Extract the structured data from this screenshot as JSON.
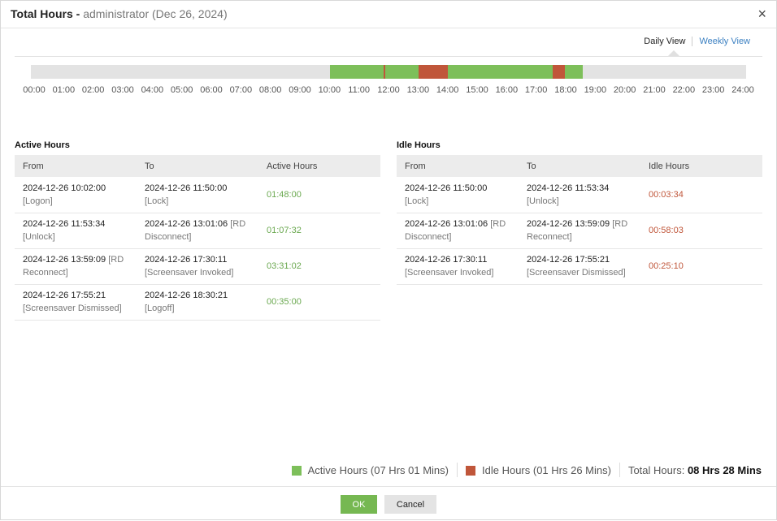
{
  "header": {
    "title": "Total Hours - ",
    "subtitle": "administrator (Dec 26, 2024)",
    "close_icon": "close-icon"
  },
  "views": {
    "daily": "Daily View",
    "weekly": "Weekly View"
  },
  "colors": {
    "active": "#7dbf5a",
    "idle": "#c0563a",
    "timeline_bg": "#e3e3e3",
    "ok_button": "#76b852"
  },
  "timeline": {
    "range_hours": [
      0,
      24
    ],
    "segments": [
      {
        "type": "active",
        "start": "10:02:00",
        "end": "11:50:00"
      },
      {
        "type": "idle",
        "start": "11:50:00",
        "end": "11:53:34"
      },
      {
        "type": "active",
        "start": "11:53:34",
        "end": "13:01:06"
      },
      {
        "type": "idle",
        "start": "13:01:06",
        "end": "13:59:09"
      },
      {
        "type": "active",
        "start": "13:59:09",
        "end": "17:30:11"
      },
      {
        "type": "idle",
        "start": "17:30:11",
        "end": "17:55:21"
      },
      {
        "type": "active",
        "start": "17:55:21",
        "end": "18:30:21"
      }
    ],
    "ticks": [
      "00:00",
      "01:00",
      "02:00",
      "03:00",
      "04:00",
      "05:00",
      "06:00",
      "07:00",
      "08:00",
      "09:00",
      "10:00",
      "11:00",
      "12:00",
      "13:00",
      "14:00",
      "15:00",
      "16:00",
      "17:00",
      "18:00",
      "19:00",
      "20:00",
      "21:00",
      "22:00",
      "23:00",
      "24:00"
    ]
  },
  "active": {
    "title": "Active Hours",
    "headers": [
      "From",
      "To",
      "Active Hours"
    ],
    "rows": [
      {
        "from": "2024-12-26 10:02:00",
        "from_tag": "[Logon]",
        "to": "2024-12-26 11:50:00",
        "to_tag": "[Lock]",
        "value": "01:48:00"
      },
      {
        "from": "2024-12-26 11:53:34",
        "from_tag": "[Unlock]",
        "to": "2024-12-26 13:01:06",
        "to_tag": "[RD Disconnect]",
        "value": "01:07:32"
      },
      {
        "from": "2024-12-26 13:59:09",
        "from_tag": "[RD Reconnect]",
        "to": "2024-12-26 17:30:11",
        "to_tag": "[Screensaver Invoked]",
        "value": "03:31:02"
      },
      {
        "from": "2024-12-26 17:55:21",
        "from_tag": "[Screensaver Dismissed]",
        "to": "2024-12-26 18:30:21",
        "to_tag": "[Logoff]",
        "value": "00:35:00"
      }
    ]
  },
  "idle": {
    "title": "Idle Hours",
    "headers": [
      "From",
      "To",
      "Idle Hours"
    ],
    "rows": [
      {
        "from": "2024-12-26 11:50:00",
        "from_tag": "[Lock]",
        "to": "2024-12-26 11:53:34",
        "to_tag": "[Unlock]",
        "value": "00:03:34"
      },
      {
        "from": "2024-12-26 13:01:06",
        "from_tag": "[RD Disconnect]",
        "to": "2024-12-26 13:59:09",
        "to_tag": "[RD Reconnect]",
        "value": "00:58:03"
      },
      {
        "from": "2024-12-26 17:30:11",
        "from_tag": "[Screensaver Invoked]",
        "to": "2024-12-26 17:55:21",
        "to_tag": "[Screensaver Dismissed]",
        "value": "00:25:10"
      }
    ]
  },
  "legend": {
    "active": "Active Hours (07 Hrs 01 Mins)",
    "idle": "Idle Hours (01 Hrs 26 Mins)",
    "total_label": "Total Hours:",
    "total_value": "08 Hrs 28 Mins"
  },
  "footer": {
    "ok": "OK",
    "cancel": "Cancel"
  }
}
